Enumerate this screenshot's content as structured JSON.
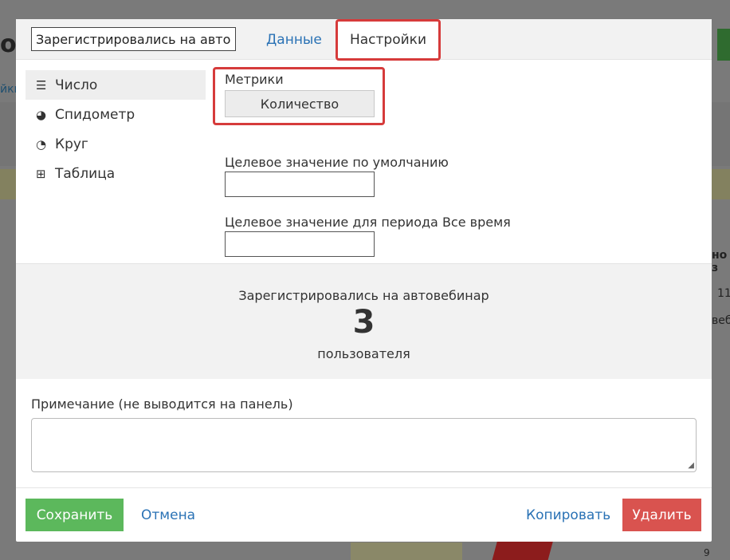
{
  "background": {
    "title_fragment": "о",
    "link_fragment": "йки",
    "right_fragment_1": "но з",
    "right_fragment_2": "11",
    "right_fragment_3": "веб",
    "corner_number": "9"
  },
  "modal": {
    "title_value": "Зарегистрировались на автовебинар",
    "tabs": {
      "data": "Данные",
      "settings": "Настройки"
    },
    "sidebar": [
      {
        "label": "Число",
        "icon": "list-icon"
      },
      {
        "label": "Спидометр",
        "icon": "speedometer-icon"
      },
      {
        "label": "Круг",
        "icon": "pie-chart-icon"
      },
      {
        "label": "Таблица",
        "icon": "table-icon"
      }
    ],
    "settings": {
      "metrics_label": "Метрики",
      "metrics_button": "Количество",
      "default_target_label": "Целевое значение по умолчанию",
      "default_target_value": "",
      "period_target_label": "Целевое значение для периода Все время",
      "period_target_value": ""
    },
    "preview": {
      "title": "Зарегистрировались на автовебинар",
      "value": "3",
      "unit": "пользователя"
    },
    "note": {
      "label": "Примечание (не выводится на панель)",
      "value": ""
    },
    "footer": {
      "save": "Сохранить",
      "cancel": "Отмена",
      "copy": "Копировать",
      "delete": "Удалить"
    }
  },
  "colors": {
    "highlight_border": "#d63b3b",
    "link": "#2a72b5",
    "save": "#5cb85c",
    "delete": "#d9534f"
  }
}
